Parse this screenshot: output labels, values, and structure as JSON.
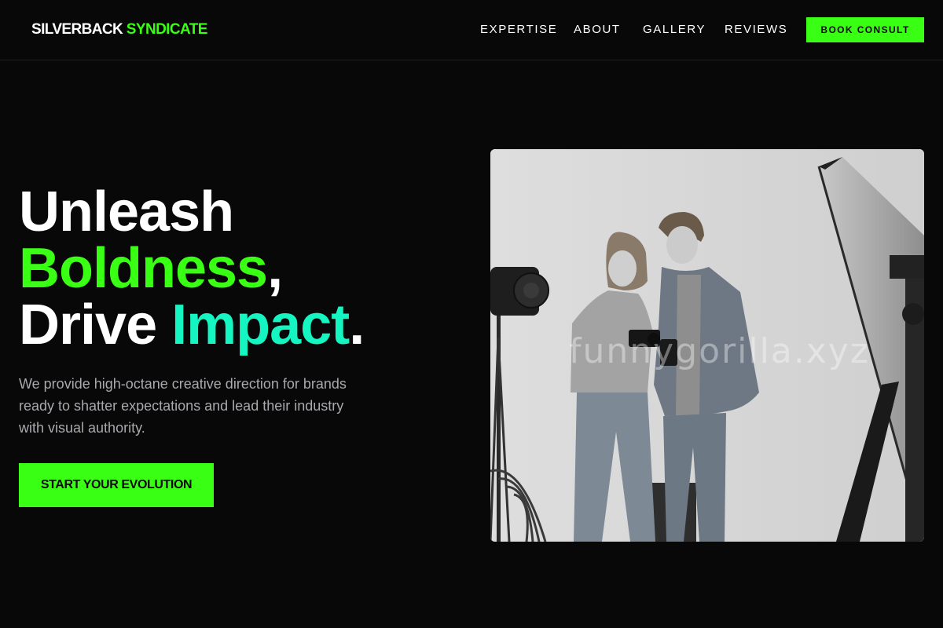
{
  "brand": {
    "word1": "SILVERBACK",
    "word2": "SYNDICATE"
  },
  "nav": {
    "items": [
      "EXPERTISE",
      "ABOUT",
      "GALLERY",
      "REVIEWS"
    ],
    "cta": "BOOK CONSULT"
  },
  "hero": {
    "line1": "Unleash",
    "line2_accent": "Boldness",
    "line2_punct": ",",
    "line3_word": "Drive",
    "line3_accent": "Impact",
    "line3_punct": ".",
    "description": "We provide high-octane creative direction for brands ready to shatter expectations and lead their industry with visual authority.",
    "cta": "START YOUR EVOLUTION"
  },
  "image": {
    "watermark": "funnygorilla.xyz"
  },
  "colors": {
    "background": "#080808",
    "accent_green": "#39ff14",
    "accent_teal": "#14f5c2",
    "muted_text": "#a9a9ae"
  }
}
